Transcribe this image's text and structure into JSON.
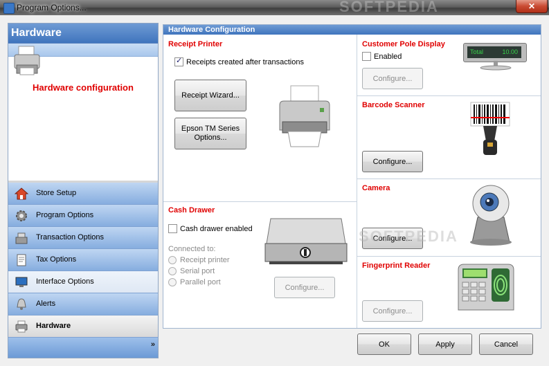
{
  "window": {
    "title": "Program Options...",
    "close_label": "✕"
  },
  "sidebar": {
    "header": "Hardware",
    "description": "Hardware configuration",
    "items": [
      {
        "label": "Store Setup",
        "icon": "house-icon"
      },
      {
        "label": "Program Options",
        "icon": "gear-icon"
      },
      {
        "label": "Transaction Options",
        "icon": "register-icon"
      },
      {
        "label": "Tax Options",
        "icon": "tax-form-icon"
      },
      {
        "label": "Interface Options",
        "icon": "monitor-icon"
      },
      {
        "label": "Alerts",
        "icon": "alert-bell-icon"
      },
      {
        "label": "Hardware",
        "icon": "printer-icon"
      }
    ],
    "more_chevron": "»"
  },
  "main": {
    "header": "Hardware Configuration",
    "receipt_printer": {
      "title": "Receipt Printer",
      "checkbox_label": "Receipts created after transactions",
      "checked": true,
      "wizard_button": "Receipt Wizard...",
      "epson_button_line1": "Epson TM Series",
      "epson_button_line2": "Options..."
    },
    "cash_drawer": {
      "title": "Cash Drawer",
      "checkbox_label": "Cash drawer enabled",
      "checked": false,
      "connected_label": "Connected to:",
      "options": [
        "Receipt printer",
        "Serial port",
        "Parallel port"
      ],
      "configure_button": "Configure..."
    },
    "pole_display": {
      "title": "Customer Pole Display",
      "checkbox_label": "Enabled",
      "checked": false,
      "configure_button": "Configure...",
      "display_left": "Total",
      "display_right": "10.00"
    },
    "barcode_scanner": {
      "title": "Barcode Scanner",
      "configure_button": "Configure..."
    },
    "camera": {
      "title": "Camera",
      "configure_button": "Configure..."
    },
    "fingerprint": {
      "title": "Fingerprint Reader",
      "configure_button": "Configure..."
    }
  },
  "footer": {
    "ok": "OK",
    "apply": "Apply",
    "cancel": "Cancel"
  },
  "watermark": {
    "top": "SOFTPEDIA",
    "middle": "SOFTPEDIA"
  },
  "colors": {
    "accent_blue": "#3f74bd",
    "section_red": "#e00000"
  }
}
